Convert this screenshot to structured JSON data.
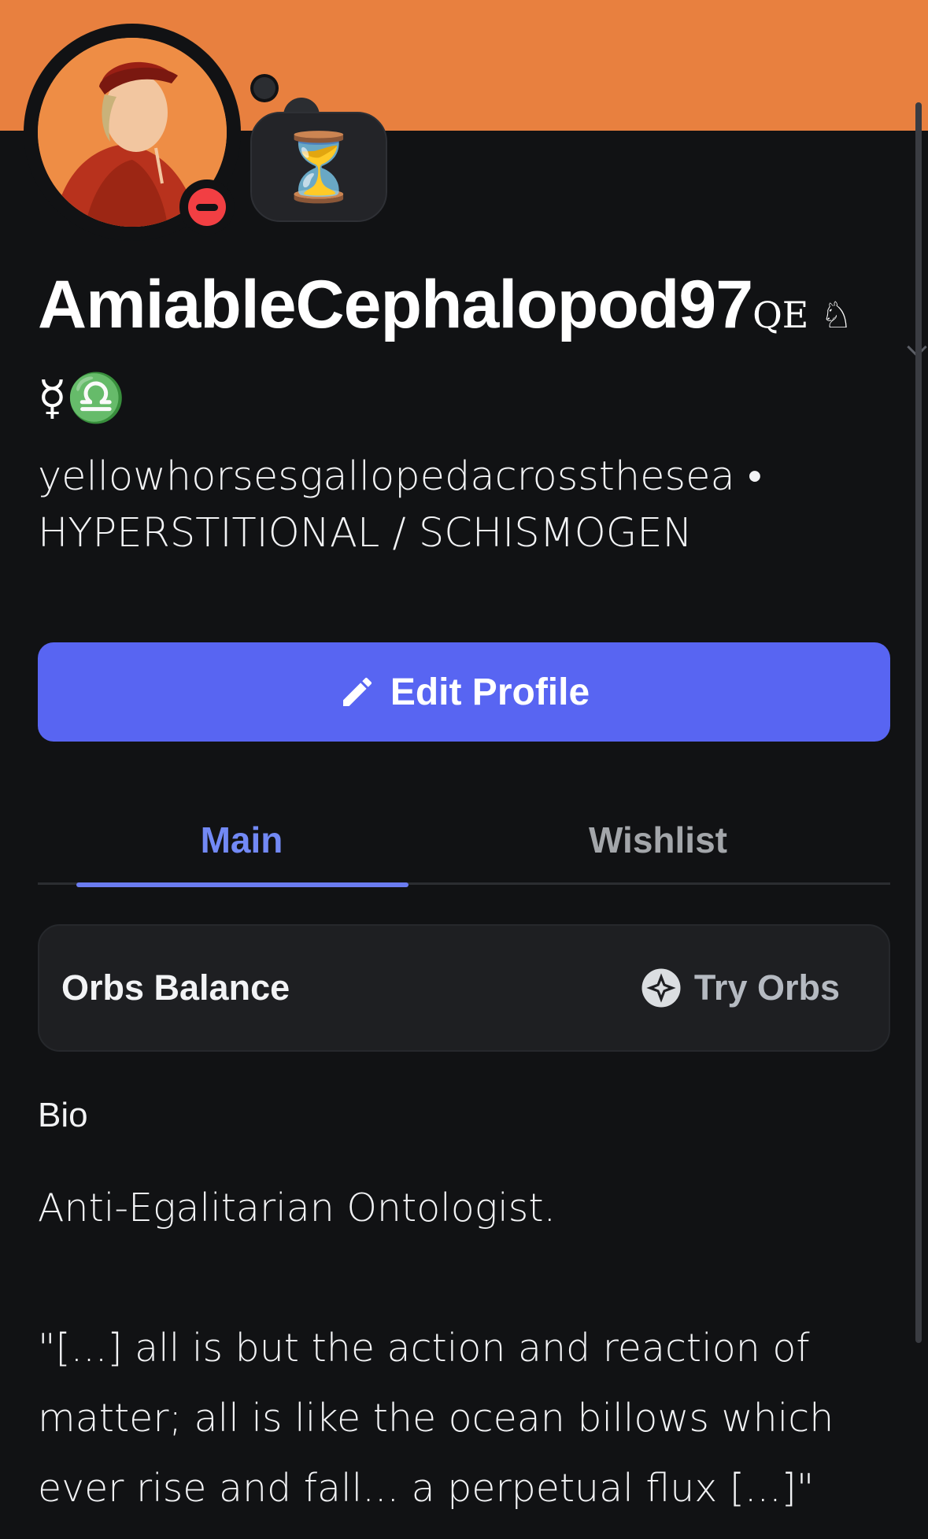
{
  "profile": {
    "username": "AmiableCephalopod97",
    "username_glyphs": "QE ♘",
    "username_glyphs_line2": "☿♎",
    "subline": "yellowhorsesgallopedacrossthesea • HYPERSTITIONAL / SCHISMOGEN",
    "status_emoji": "⏳",
    "status": "do-not-disturb"
  },
  "colors": {
    "banner": "#e8803f",
    "accent": "#5865f2",
    "background": "#111214",
    "dnd": "#f23f43"
  },
  "actions": {
    "edit_profile_label": "Edit Profile"
  },
  "tabs": [
    {
      "label": "Main",
      "active": true
    },
    {
      "label": "Wishlist",
      "active": false
    }
  ],
  "orbs": {
    "label": "Orbs Balance",
    "cta": "Try Orbs"
  },
  "bio": {
    "heading": "Bio",
    "text": "Anti-Egalitarian Ontologist.\n\n\"[...] all is but the action and reaction of matter; all is like the ocean billows which ever rise and fall... a perpetual flux [...]\""
  }
}
